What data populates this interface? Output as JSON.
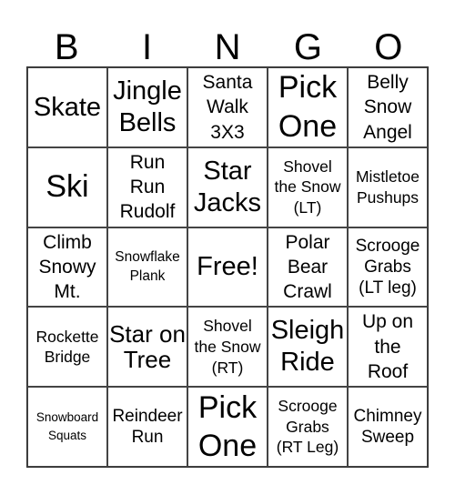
{
  "header": [
    "B",
    "I",
    "N",
    "G",
    "O"
  ],
  "cells": [
    {
      "text": "Skate",
      "size": "s30"
    },
    {
      "text": "Jingle\nBells",
      "size": "s30"
    },
    {
      "text": "Santa\nWalk\n3X3",
      "size": "s22"
    },
    {
      "text": "Pick\nOne",
      "size": "s36"
    },
    {
      "text": "Belly\nSnow\nAngel",
      "size": "s22"
    },
    {
      "text": "Ski",
      "size": "s36"
    },
    {
      "text": "Run\nRun\nRudolf",
      "size": "s22"
    },
    {
      "text": "Star\nJacks",
      "size": "s30"
    },
    {
      "text": "Shovel\nthe Snow\n(LT)",
      "size": "s18"
    },
    {
      "text": "Mistletoe\nPushups",
      "size": "s18"
    },
    {
      "text": "Climb\nSnowy\nMt.",
      "size": "s22"
    },
    {
      "text": "Snowflake\nPlank",
      "size": "s16"
    },
    {
      "text": "Free!",
      "size": "s30"
    },
    {
      "text": "Polar\nBear\nCrawl",
      "size": "s22"
    },
    {
      "text": "Scrooge\nGrabs\n(LT leg)",
      "size": "s20"
    },
    {
      "text": "Rockette\nBridge",
      "size": "s18"
    },
    {
      "text": "Star on\nTree",
      "size": "s26"
    },
    {
      "text": "Shovel\nthe Snow\n(RT)",
      "size": "s18"
    },
    {
      "text": "Sleigh\nRide",
      "size": "s30"
    },
    {
      "text": "Up on\nthe\nRoof",
      "size": "s22"
    },
    {
      "text": "Snowboard\nSquats",
      "size": "s14"
    },
    {
      "text": "Reindeer\nRun",
      "size": "s20"
    },
    {
      "text": "Pick\nOne",
      "size": "s36"
    },
    {
      "text": "Scrooge\nGrabs\n(RT Leg)",
      "size": "s18"
    },
    {
      "text": "Chimney\nSweep",
      "size": "s20"
    }
  ]
}
